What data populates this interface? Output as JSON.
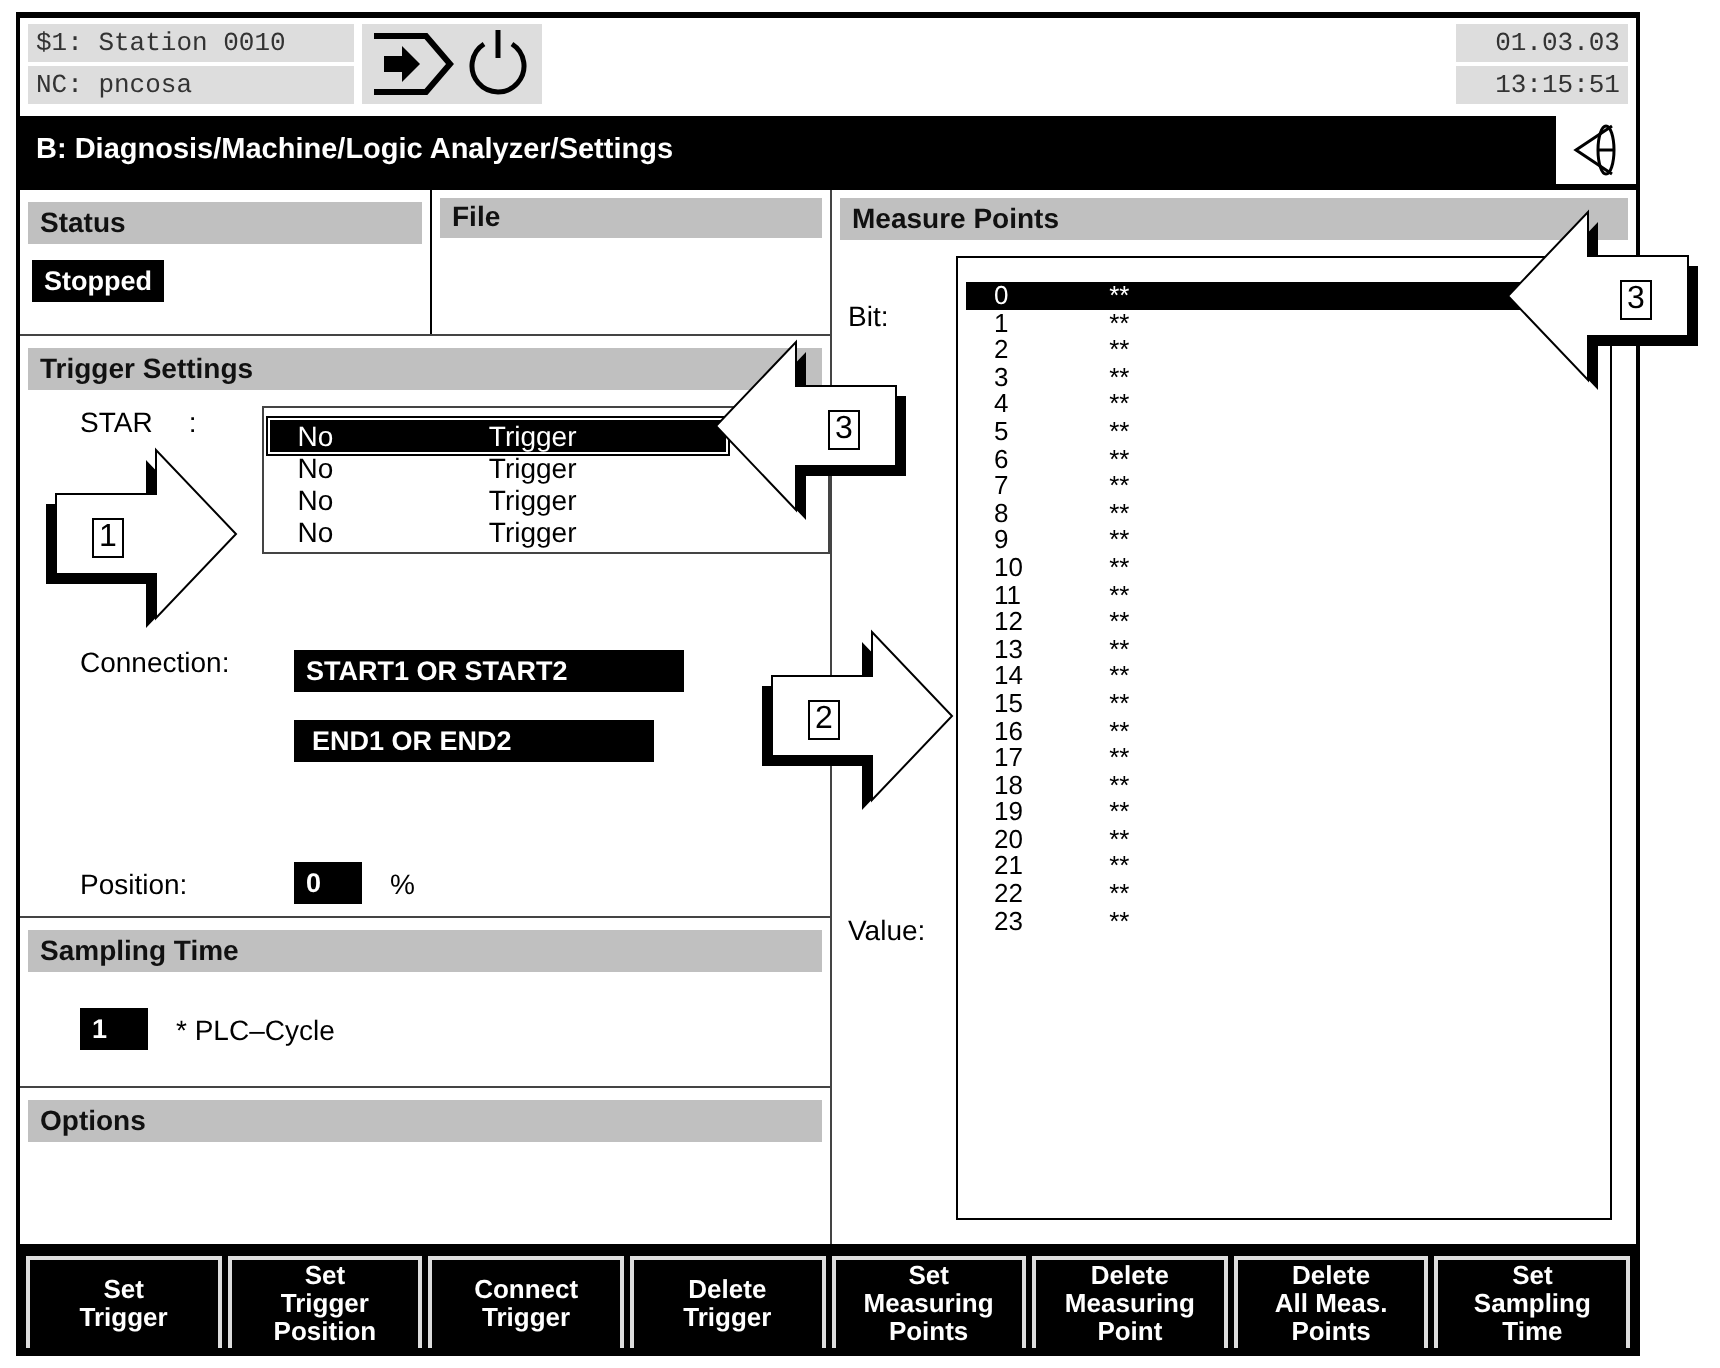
{
  "header": {
    "station": "$1: Station 0010",
    "nc": "NC: pncosa",
    "date": "01.03.03",
    "time": "13:15:51"
  },
  "title": "B: Diagnosis/Machine/Logic Analyzer/Settings",
  "status": {
    "heading": "Status",
    "value": "Stopped"
  },
  "file": {
    "heading": "File"
  },
  "trigger": {
    "heading": "Trigger Settings",
    "start_label": "STAR",
    "start_colon": ":",
    "entries": [
      {
        "col1": "No",
        "col2": "Trigger",
        "selected": true
      },
      {
        "col1": "No",
        "col2": "Trigger",
        "selected": false
      },
      {
        "col1": "No",
        "col2": "Trigger",
        "selected": false
      },
      {
        "col1": "No",
        "col2": "Trigger",
        "selected": false
      }
    ],
    "connection_label": "Connection:",
    "connections": [
      "START1 OR START2",
      "END1 OR END2"
    ],
    "position_label": "Position:",
    "position_value": "0",
    "position_unit": "%"
  },
  "sampling": {
    "heading": "Sampling Time",
    "value": "1",
    "unit": "* PLC–Cycle"
  },
  "options": {
    "heading": "Options"
  },
  "measure": {
    "heading": "Measure Points",
    "bit_label": "Bit:",
    "value_label": "Value:",
    "points": [
      {
        "bit": "0",
        "value": "**",
        "selected": true
      },
      {
        "bit": "1",
        "value": "**",
        "selected": false
      },
      {
        "bit": "2",
        "value": "**",
        "selected": false
      },
      {
        "bit": "3",
        "value": "**",
        "selected": false
      },
      {
        "bit": "4",
        "value": "**",
        "selected": false
      },
      {
        "bit": "5",
        "value": "**",
        "selected": false
      },
      {
        "bit": "6",
        "value": "**",
        "selected": false
      },
      {
        "bit": "7",
        "value": "**",
        "selected": false
      },
      {
        "bit": "8",
        "value": "**",
        "selected": false
      },
      {
        "bit": "9",
        "value": "**",
        "selected": false
      },
      {
        "bit": "10",
        "value": "**",
        "selected": false
      },
      {
        "bit": "11",
        "value": "**",
        "selected": false
      },
      {
        "bit": "12",
        "value": "**",
        "selected": false
      },
      {
        "bit": "13",
        "value": "**",
        "selected": false
      },
      {
        "bit": "14",
        "value": "**",
        "selected": false
      },
      {
        "bit": "15",
        "value": "**",
        "selected": false
      },
      {
        "bit": "16",
        "value": "**",
        "selected": false
      },
      {
        "bit": "17",
        "value": "**",
        "selected": false
      },
      {
        "bit": "18",
        "value": "**",
        "selected": false
      },
      {
        "bit": "19",
        "value": "**",
        "selected": false
      },
      {
        "bit": "20",
        "value": "**",
        "selected": false
      },
      {
        "bit": "21",
        "value": "**",
        "selected": false
      },
      {
        "bit": "22",
        "value": "**",
        "selected": false
      },
      {
        "bit": "23",
        "value": "**",
        "selected": false
      }
    ]
  },
  "softkeys": [
    {
      "lines": [
        "Set",
        "Trigger"
      ]
    },
    {
      "lines": [
        "Set",
        "Trigger",
        "Position"
      ]
    },
    {
      "lines": [
        "Connect",
        "Trigger"
      ]
    },
    {
      "lines": [
        "Delete",
        "Trigger"
      ]
    },
    {
      "lines": [
        "Set",
        "Measuring",
        "Points"
      ]
    },
    {
      "lines": [
        "Delete",
        "Measuring",
        "Point"
      ]
    },
    {
      "lines": [
        "Delete",
        "All Meas.",
        "Points"
      ]
    },
    {
      "lines": [
        "Set",
        "Sampling",
        "Time"
      ]
    }
  ],
  "callouts": [
    {
      "number": "1",
      "kind": "right"
    },
    {
      "number": "3",
      "kind": "left"
    },
    {
      "number": "2",
      "kind": "right"
    },
    {
      "number": "3",
      "kind": "left"
    }
  ]
}
